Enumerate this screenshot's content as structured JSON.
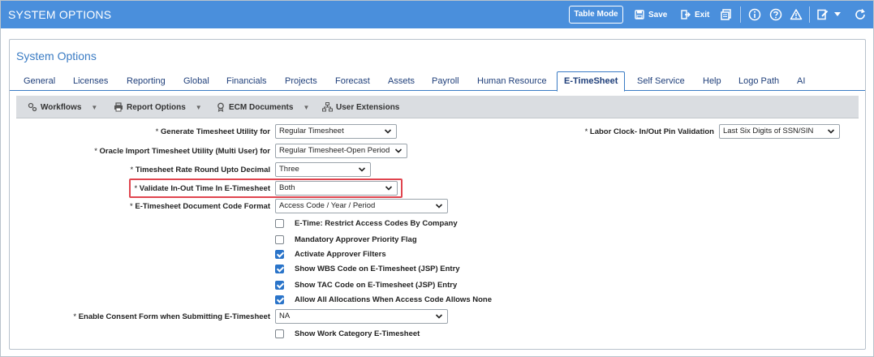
{
  "header": {
    "title": "SYSTEM OPTIONS",
    "table_mode": "Table Mode",
    "save": "Save",
    "exit": "Exit"
  },
  "panel": {
    "title": "System Options"
  },
  "tabs": [
    {
      "label": "General"
    },
    {
      "label": "Licenses"
    },
    {
      "label": "Reporting"
    },
    {
      "label": "Global"
    },
    {
      "label": "Financials"
    },
    {
      "label": "Projects"
    },
    {
      "label": "Forecast"
    },
    {
      "label": "Assets"
    },
    {
      "label": "Payroll"
    },
    {
      "label": "Human Resource"
    },
    {
      "label": "E-TimeSheet",
      "active": true
    },
    {
      "label": "Self Service"
    },
    {
      "label": "Help"
    },
    {
      "label": "Logo Path"
    },
    {
      "label": "AI"
    }
  ],
  "toolbar": {
    "workflows": "Workflows",
    "report_options": "Report Options",
    "ecm_documents": "ECM Documents",
    "user_extensions": "User Extensions"
  },
  "form": {
    "required_mark": "*",
    "generate_timesheet": {
      "label": "Generate Timesheet Utility for",
      "value": "Regular Timesheet"
    },
    "oracle_import": {
      "label": "Oracle Import Timesheet Utility (Multi User) for",
      "value": "Regular Timesheet-Open Period"
    },
    "rate_round": {
      "label": "Timesheet Rate Round Upto Decimal",
      "value": "Three"
    },
    "validate_in_out": {
      "label": "Validate In-Out Time In E-Timesheet",
      "value": "Both"
    },
    "doc_code_format": {
      "label": "E-Timesheet Document Code Format",
      "value": "Access Code / Year / Period"
    },
    "labor_clock": {
      "label": "Labor Clock- In/Out Pin Validation",
      "value": "Last Six Digits of SSN/SIN"
    },
    "consent_form": {
      "label": "Enable Consent Form when Submitting E-Timesheet",
      "value": "NA"
    },
    "checkboxes": [
      {
        "label": "E-Time: Restrict Access Codes By Company",
        "checked": false
      },
      {
        "label": "Mandatory Approver Priority Flag",
        "checked": false
      },
      {
        "label": "Activate Approver Filters",
        "checked": true
      },
      {
        "label": "Show WBS Code on E-Timesheet (JSP) Entry",
        "checked": true
      },
      {
        "label": "Show TAC Code on E-Timesheet (JSP) Entry",
        "checked": true
      },
      {
        "label": "Allow All Allocations When Access Code Allows None",
        "checked": true
      }
    ],
    "show_work_category": {
      "label": "Show Work Category E-Timesheet",
      "checked": false
    }
  }
}
